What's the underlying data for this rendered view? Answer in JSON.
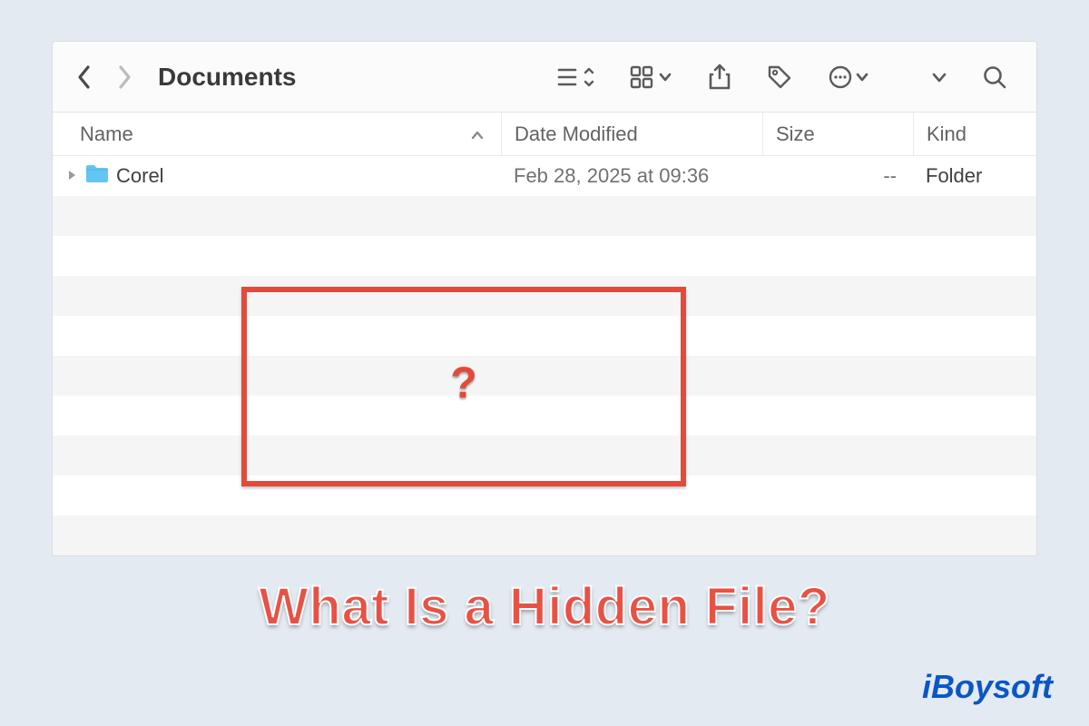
{
  "toolbar": {
    "title": "Documents"
  },
  "columns": {
    "name": "Name",
    "date": "Date Modified",
    "size": "Size",
    "kind": "Kind"
  },
  "rows": [
    {
      "name": "Corel",
      "date": "Feb 28, 2025 at 09:36",
      "size": "--",
      "kind": "Folder"
    }
  ],
  "overlay": {
    "mark": "?",
    "caption": "What Is a Hidden File?"
  },
  "brand": "iBoysoft"
}
